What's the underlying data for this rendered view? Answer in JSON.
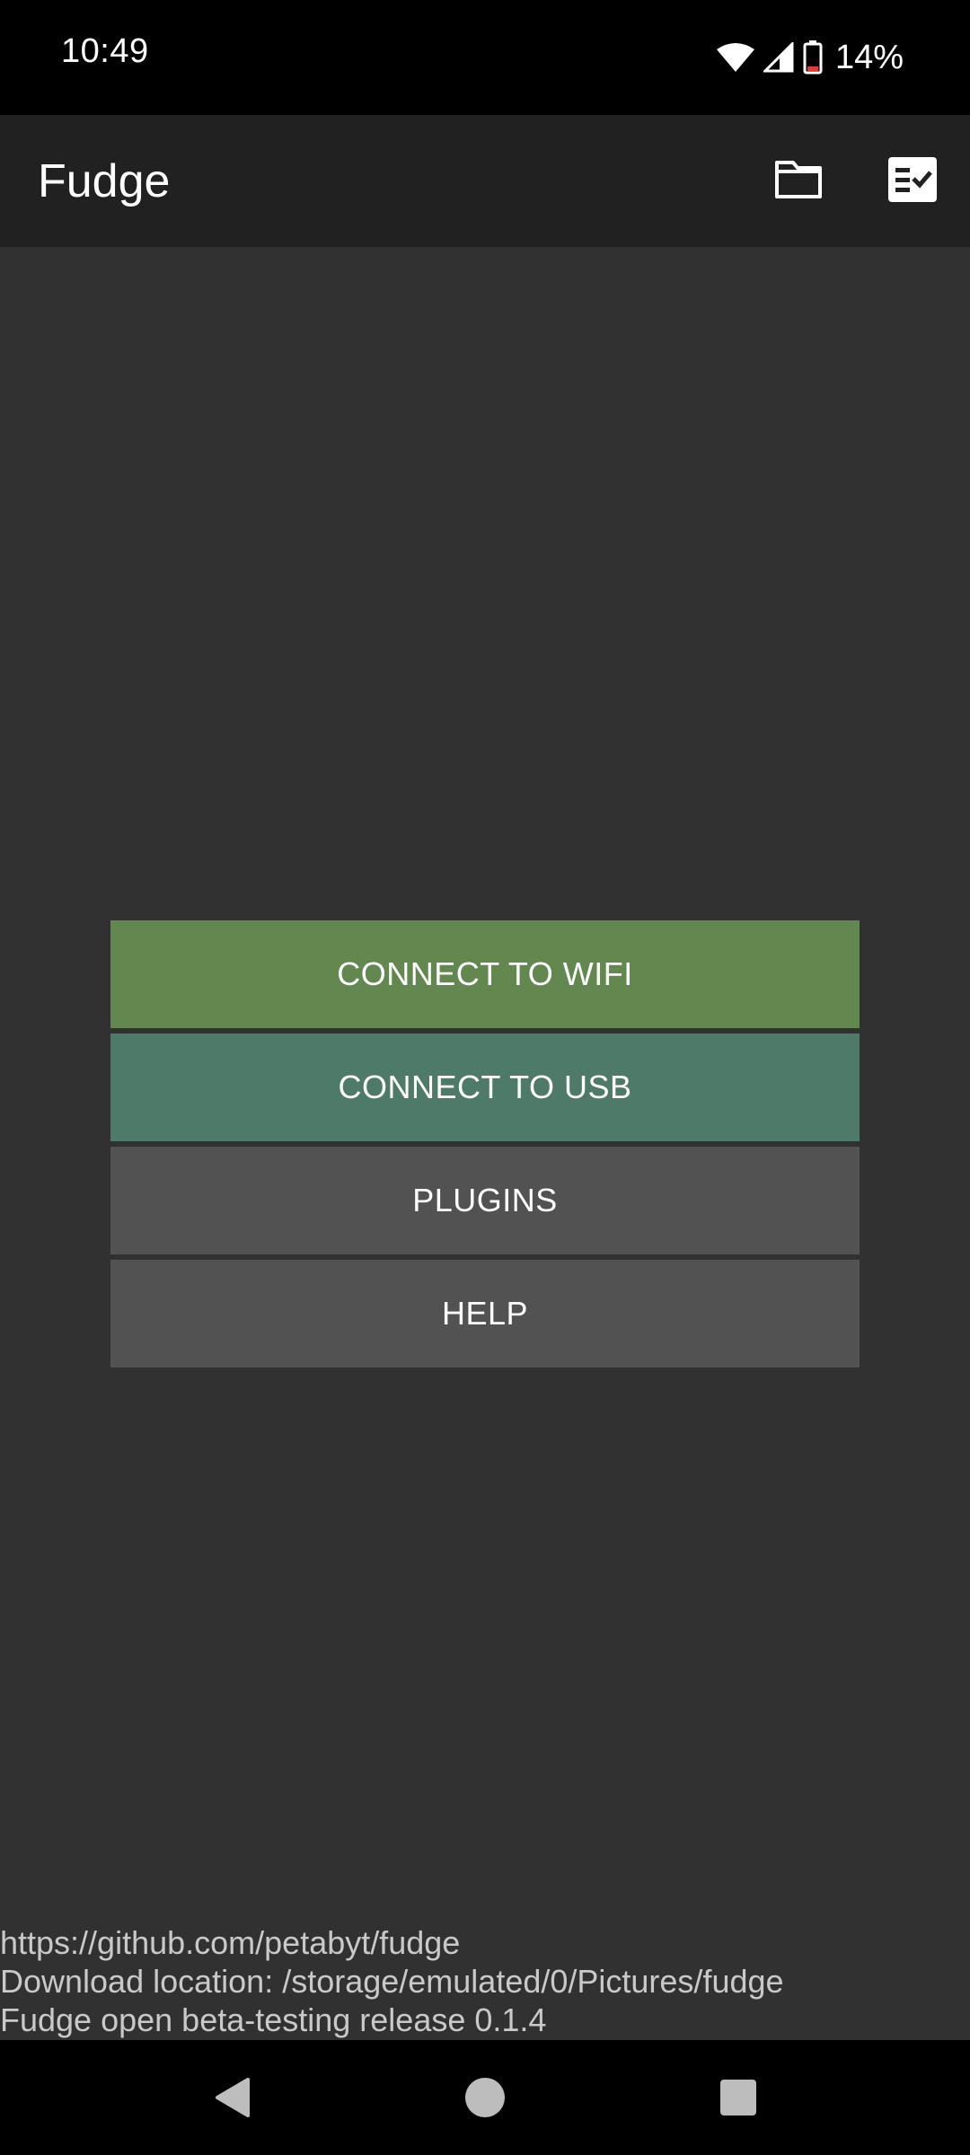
{
  "status_bar": {
    "time": "10:49",
    "battery_percent": "14%",
    "icons": [
      "wifi-icon",
      "cell-signal-icon",
      "battery-icon"
    ]
  },
  "app_bar": {
    "title": "Fudge",
    "actions": [
      {
        "icon": "folder-icon"
      },
      {
        "icon": "checklist-icon"
      }
    ]
  },
  "menu": {
    "buttons": [
      {
        "label": "CONNECT TO WIFI",
        "color": "#62874f"
      },
      {
        "label": "CONNECT TO USB",
        "color": "#4d7a69"
      },
      {
        "label": "PLUGINS",
        "color": "#525252"
      },
      {
        "label": "HELP",
        "color": "#525252"
      }
    ]
  },
  "footer": {
    "lines": [
      "https://github.com/petabyt/fudge",
      "Download location: /storage/emulated/0/Pictures/fudge",
      "Fudge open beta-testing release 0.1.4"
    ]
  },
  "nav_bar": {
    "buttons": [
      "back-icon",
      "home-icon",
      "recents-icon"
    ]
  },
  "colors": {
    "background": "#313131",
    "app_bar": "#212121",
    "status_bar": "#000000"
  }
}
